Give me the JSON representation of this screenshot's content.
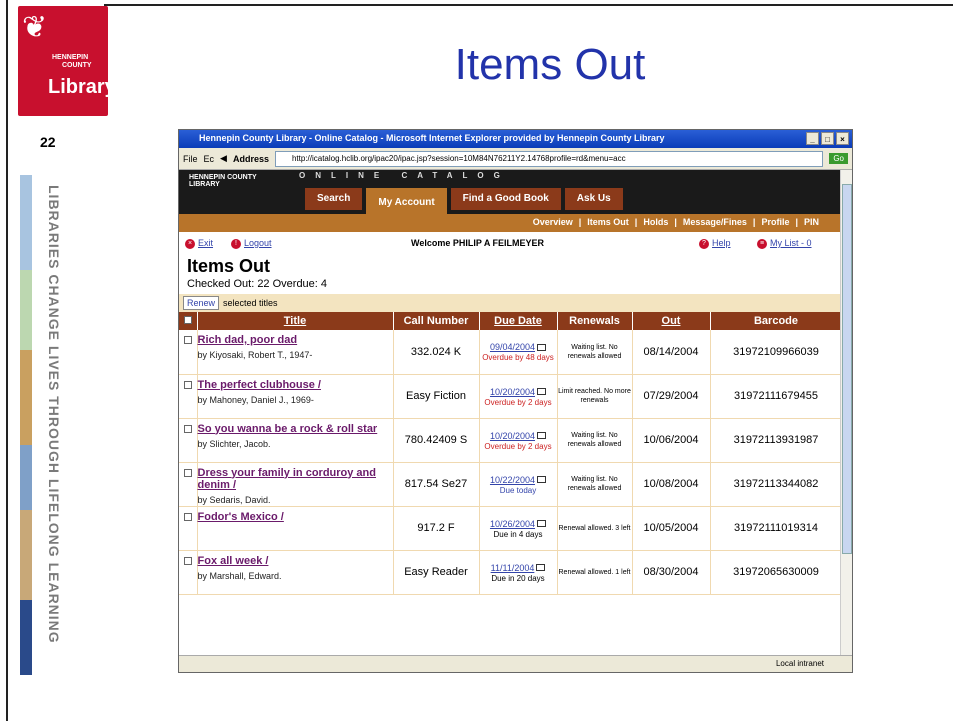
{
  "slide": {
    "title": "Items Out",
    "page_number": "22",
    "side_text": "LIBRARIES CHANGE LIVES THROUGH LIFELONG LEARNING",
    "logo": {
      "top": "HENNEPIN",
      "middle": "COUNTY",
      "bottom": "Library"
    },
    "stripe_colors": [
      "#a8c4e0",
      "#bcd7b0",
      "#c9a060",
      "#7fa0c8",
      "#c8a878",
      "#2a4a8a"
    ]
  },
  "browser": {
    "window_title": "Hennepin County Library - Online Catalog - Microsoft Internet Explorer provided by Hennepin County Library",
    "menu_file": "File",
    "menu_edit": "Ec",
    "address_label": "Address",
    "url": "http://icatalog.hclib.org/ipac20/ipac.jsp?session=10M84N76211Y2.14768profile=rd&menu=acc",
    "go_label": "Go",
    "zone": "Local intranet"
  },
  "catalog": {
    "online_catalog": "ONLINE CATALOG",
    "logo_text": "HENNEPIN COUNTY LIBRARY",
    "tabs": [
      {
        "label": "Search",
        "active": false
      },
      {
        "label": "My Account",
        "active": true
      },
      {
        "label": "Find a Good Book",
        "active": false
      },
      {
        "label": "Ask Us",
        "active": false
      }
    ],
    "subnav": [
      "Overview",
      "Items Out",
      "Holds",
      "Message/Fines",
      "Profile",
      "PIN"
    ]
  },
  "account": {
    "exit": "Exit",
    "logout": "Logout",
    "welcome": "Welcome PHILIP A FEILMEYER",
    "help": "Help",
    "my_list": "My List - 0",
    "heading": "Items Out",
    "counts": "Checked Out: 22   Overdue: 4",
    "renew_button": "Renew",
    "renew_label": "selected titles"
  },
  "table": {
    "headers": [
      "Title",
      "Call Number",
      "Due Date",
      "Renewals",
      "Out",
      "Barcode"
    ],
    "rows": [
      {
        "title": "Rich dad, poor dad",
        "author": "by Kiyosaki, Robert T., 1947-",
        "call": "332.024 K",
        "due": "09/04/2004",
        "due_status": "Overdue by 48 days",
        "status_type": "over",
        "renewals": "Waiting list. No renewals allowed",
        "out": "08/14/2004",
        "barcode": "31972109966039"
      },
      {
        "title": "The perfect clubhouse /",
        "author": "by Mahoney, Daniel J., 1969-",
        "call": "Easy Fiction",
        "due": "10/20/2004",
        "due_status": "Overdue by 2 days",
        "status_type": "over",
        "renewals": "Limit reached. No more renewals",
        "out": "07/29/2004",
        "barcode": "31972111679455"
      },
      {
        "title": "So you wanna be a rock & roll star",
        "author": "by Slichter, Jacob.",
        "call": "780.42409 S",
        "due": "10/20/2004",
        "due_status": "Overdue by 2 days",
        "status_type": "over",
        "renewals": "Waiting list. No renewals allowed",
        "out": "10/06/2004",
        "barcode": "31972113931987"
      },
      {
        "title": "Dress your family in corduroy and denim /",
        "author": "by Sedaris, David.",
        "call": "817.54 Se27",
        "due": "10/22/2004",
        "due_status": "Due today",
        "status_type": "today",
        "renewals": "Waiting list. No renewals allowed",
        "out": "10/08/2004",
        "barcode": "31972113344082"
      },
      {
        "title": "Fodor's Mexico /",
        "author": "",
        "call": "917.2 F",
        "due": "10/26/2004",
        "due_status": "Due in 4 days",
        "status_type": "normal",
        "renewals": "Renewal allowed. 3 left",
        "out": "10/05/2004",
        "barcode": "31972111019314"
      },
      {
        "title": "Fox all week /",
        "author": "by Marshall, Edward.",
        "call": "Easy Reader",
        "due": "11/11/2004",
        "due_status": "Due in 20 days",
        "status_type": "normal",
        "renewals": "Renewal allowed. 1 left",
        "out": "08/30/2004",
        "barcode": "31972065630009"
      }
    ]
  }
}
